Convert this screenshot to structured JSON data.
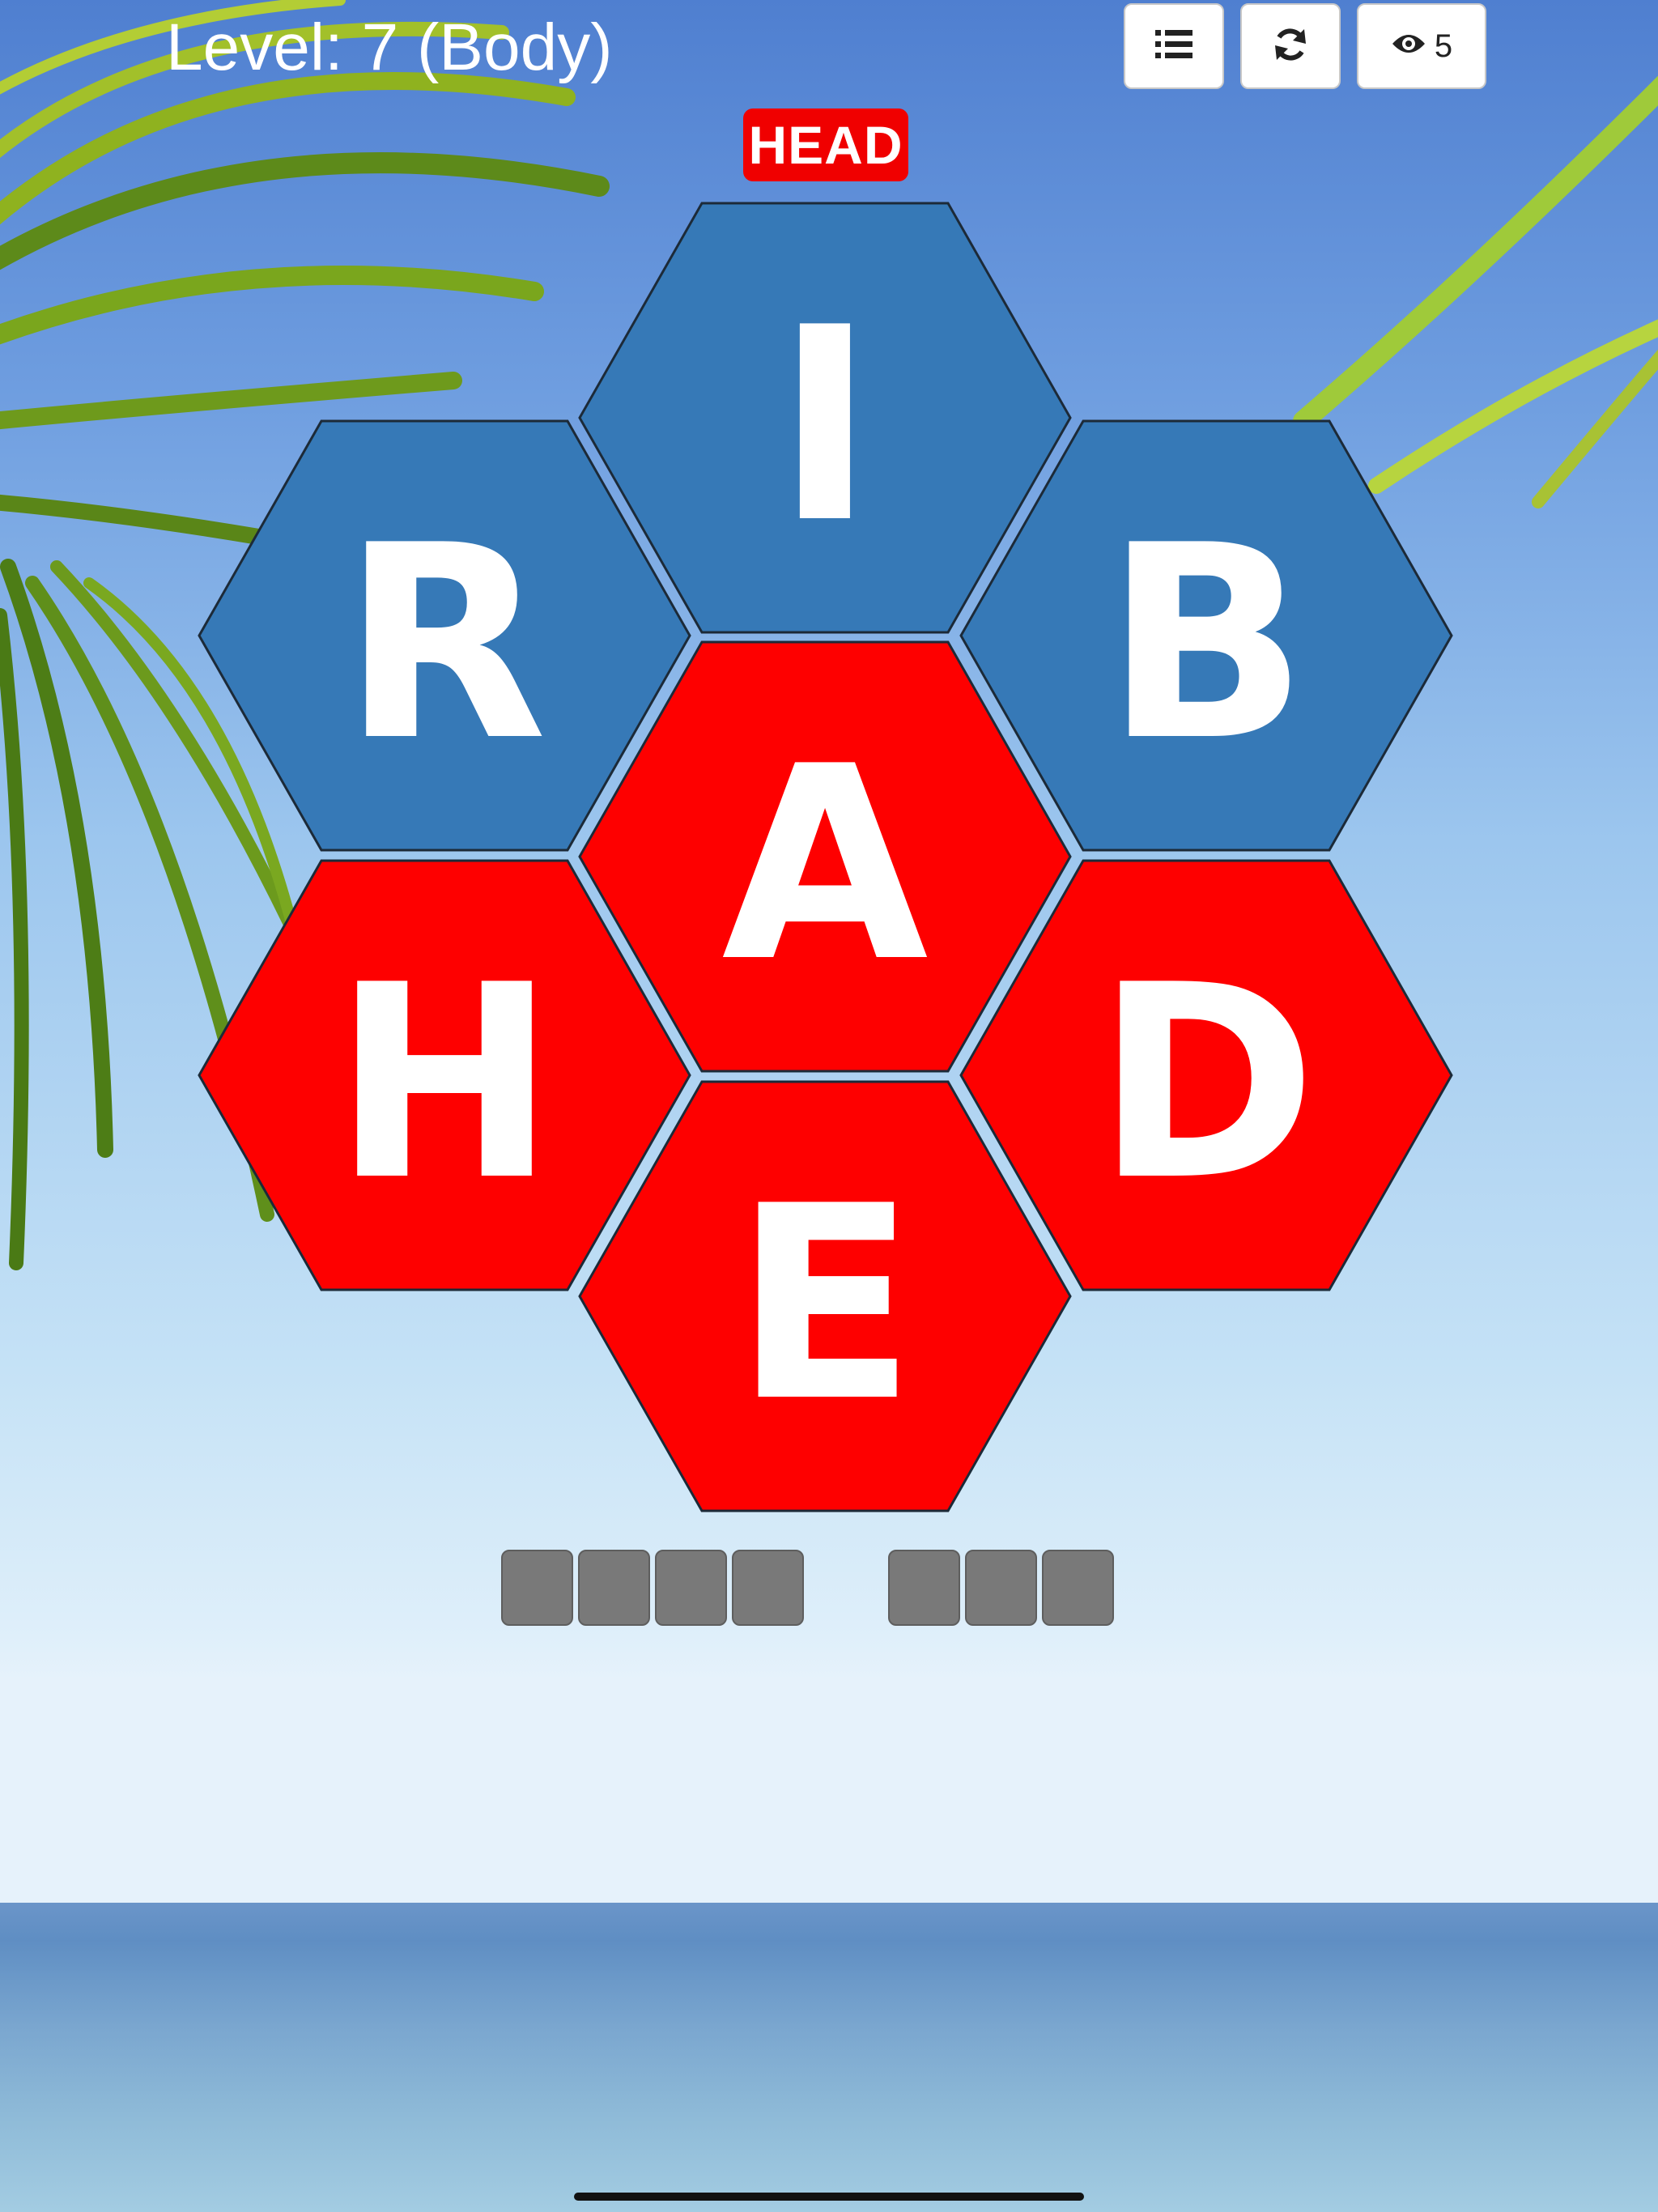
{
  "header": {
    "level_label": "Level: 7 (Body)"
  },
  "toolbar": {
    "list_icon": "list-icon",
    "refresh_icon": "refresh-icon",
    "hint_icon": "eye-icon",
    "hint_count": "5"
  },
  "clue": {
    "label": "HEAD",
    "color": "#f00000"
  },
  "board": {
    "colors": {
      "blue": "#3679b7",
      "red": "#fe0000"
    },
    "tiles": [
      {
        "letter": "I",
        "color": "blue",
        "position": "top"
      },
      {
        "letter": "R",
        "color": "blue",
        "position": "upper-left"
      },
      {
        "letter": "B",
        "color": "blue",
        "position": "upper-right"
      },
      {
        "letter": "A",
        "color": "red",
        "position": "center"
      },
      {
        "letter": "H",
        "color": "red",
        "position": "lower-left"
      },
      {
        "letter": "D",
        "color": "red",
        "position": "lower-right"
      },
      {
        "letter": "E",
        "color": "red",
        "position": "bottom"
      }
    ]
  },
  "answer": {
    "word_lengths": [
      4,
      3
    ]
  }
}
